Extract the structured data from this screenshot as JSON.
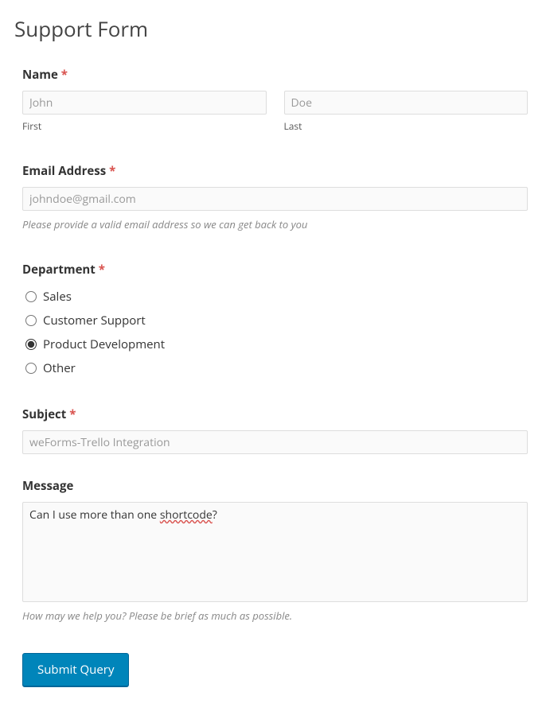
{
  "page": {
    "title": "Support Form"
  },
  "fields": {
    "name": {
      "label": "Name",
      "required": true,
      "first": {
        "value": "John",
        "sublabel": "First"
      },
      "last": {
        "value": "Doe",
        "sublabel": "Last"
      }
    },
    "email": {
      "label": "Email Address",
      "required": true,
      "value": "johndoe@gmail.com",
      "help": "Please provide a valid email address so we can get back to you"
    },
    "department": {
      "label": "Department",
      "required": true,
      "options": [
        {
          "label": "Sales",
          "selected": false
        },
        {
          "label": "Customer Support",
          "selected": false
        },
        {
          "label": "Product Development",
          "selected": true
        },
        {
          "label": "Other",
          "selected": false
        }
      ]
    },
    "subject": {
      "label": "Subject",
      "required": true,
      "value": "weForms-Trello Integration"
    },
    "message": {
      "label": "Message",
      "required": false,
      "value_pre": "Can I use more than one ",
      "value_spell": "shortcode",
      "value_post": "?",
      "help": "How may we help you? Please be brief as much as possible."
    }
  },
  "submit": {
    "label": "Submit Query"
  },
  "required_glyph": "*"
}
